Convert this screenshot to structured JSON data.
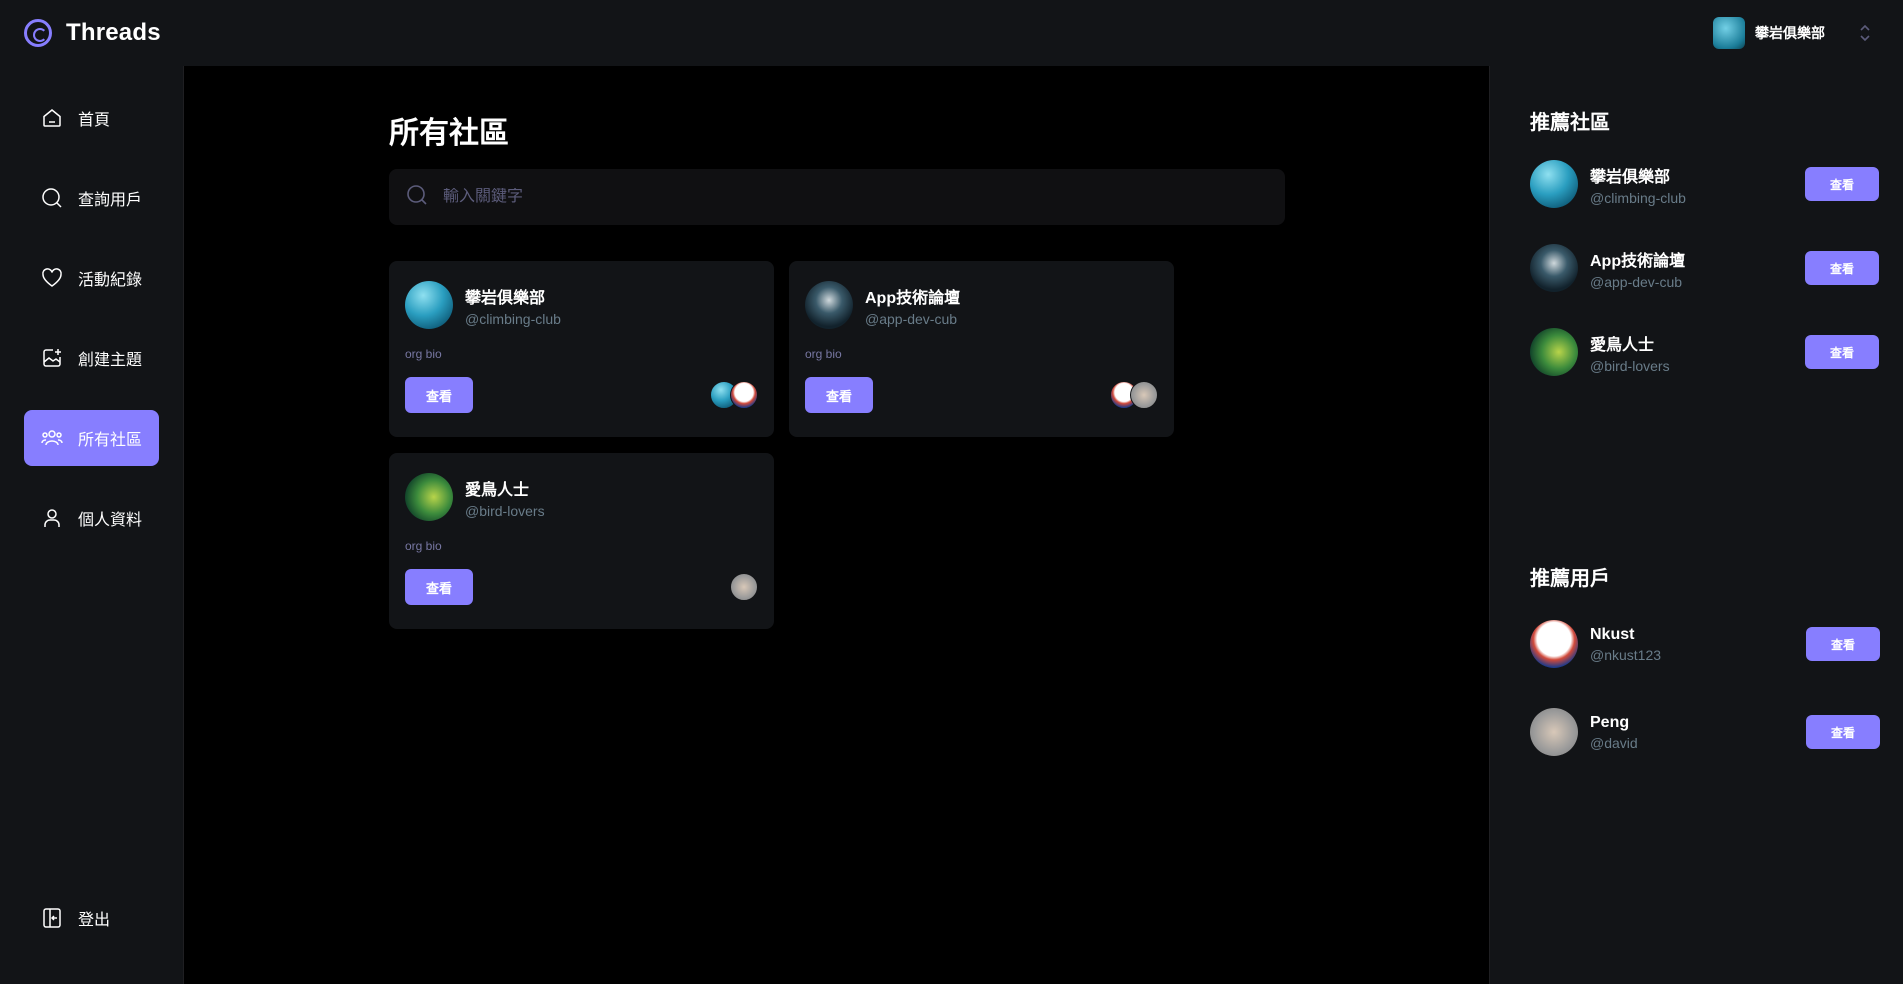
{
  "brand": {
    "name": "Threads"
  },
  "org_switcher": {
    "name": "攀岩俱樂部"
  },
  "nav": {
    "items": [
      {
        "label": "首頁",
        "icon": "home-icon",
        "active": false
      },
      {
        "label": "查詢用戶",
        "icon": "search-icon",
        "active": false
      },
      {
        "label": "活動紀錄",
        "icon": "heart-icon",
        "active": false
      },
      {
        "label": "創建主題",
        "icon": "create-icon",
        "active": false
      },
      {
        "label": "所有社區",
        "icon": "community-icon",
        "active": true
      },
      {
        "label": "個人資料",
        "icon": "user-icon",
        "active": false
      }
    ],
    "logout_label": "登出"
  },
  "main": {
    "title": "所有社區",
    "search_placeholder": "輸入關鍵字",
    "communities": [
      {
        "name": "攀岩俱樂部",
        "handle": "@climbing-club",
        "bio": "org bio",
        "button": "查看",
        "avatar": "av-climb",
        "members": [
          "av-climb",
          "av-nkust"
        ]
      },
      {
        "name": "App技術論壇",
        "handle": "@app-dev-cub",
        "bio": "org bio",
        "button": "查看",
        "avatar": "av-app",
        "members": [
          "av-nkust",
          "av-peng"
        ]
      },
      {
        "name": "愛鳥人士",
        "handle": "@bird-lovers",
        "bio": "org bio",
        "button": "查看",
        "avatar": "av-bird",
        "members": [
          "av-peng"
        ]
      }
    ]
  },
  "right": {
    "communities_title": "推薦社區",
    "communities": [
      {
        "name": "攀岩俱樂部",
        "handle": "@climbing-club",
        "button": "查看"
      },
      {
        "name": "App技術論壇",
        "handle": "@app-dev-cub",
        "button": "查看"
      },
      {
        "name": "愛鳥人士",
        "handle": "@bird-lovers",
        "button": "查看"
      }
    ],
    "users_title": "推薦用戶",
    "users": [
      {
        "name": "Nkust",
        "handle": "@nkust123",
        "button": "查看"
      },
      {
        "name": "Peng",
        "handle": "@david",
        "button": "查看"
      }
    ]
  },
  "colors": {
    "accent": "#877EFF",
    "panel": "#121417",
    "muted": "#697c89"
  }
}
